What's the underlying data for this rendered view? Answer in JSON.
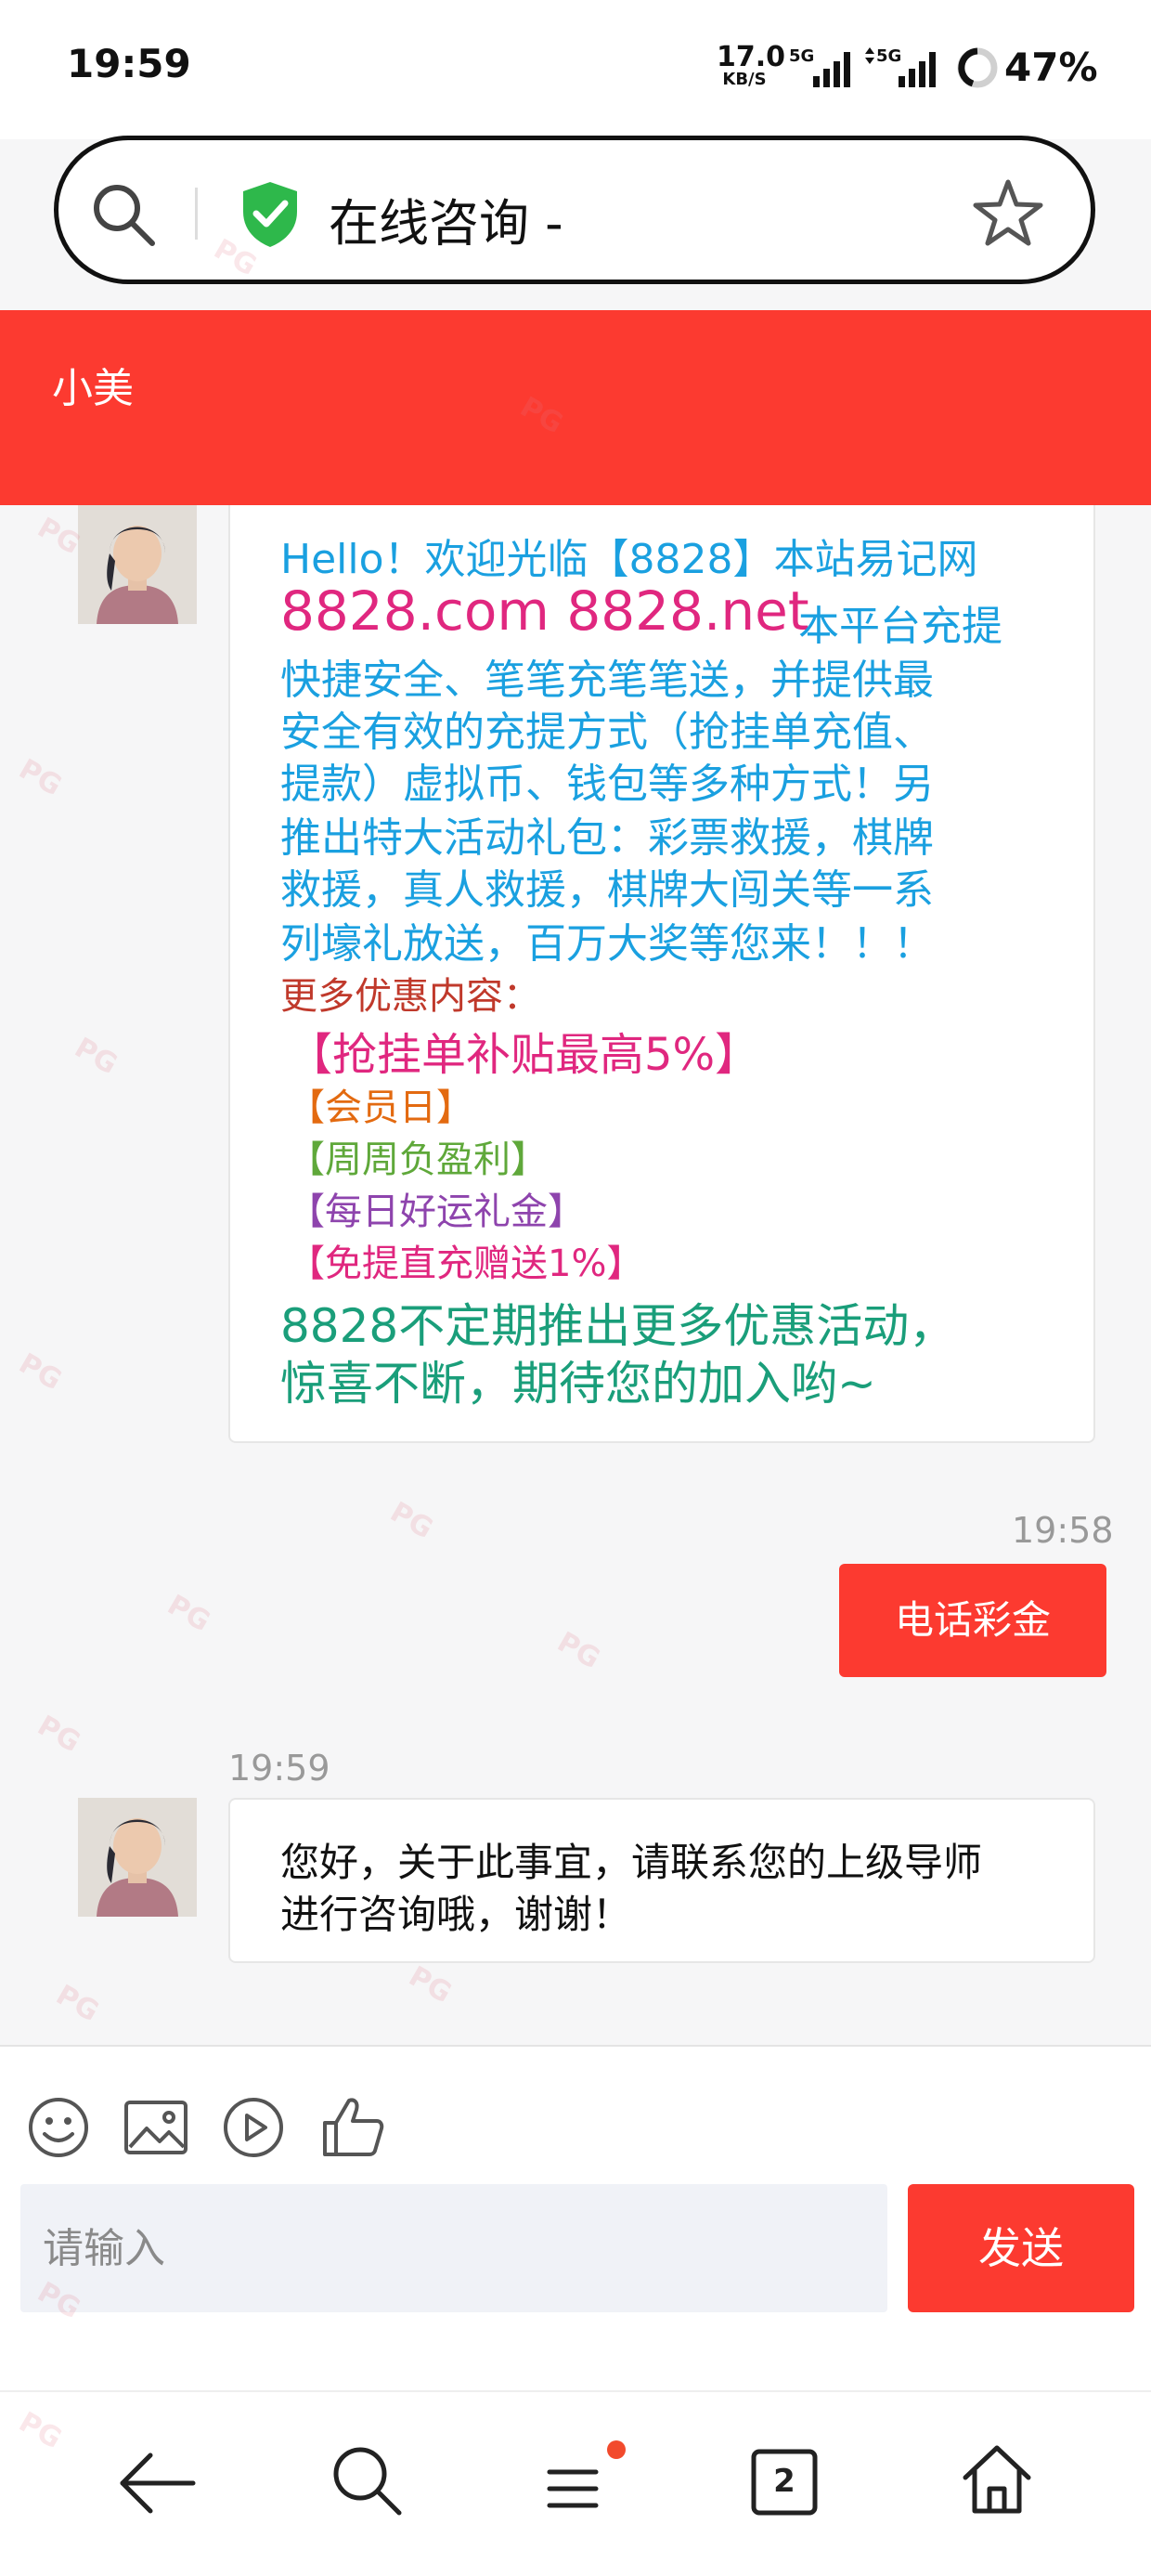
{
  "status_bar": {
    "time": "19:59",
    "net_speed_value": "17.0",
    "net_speed_unit": "KB/S",
    "signal1_label": "5G",
    "signal2_label": "5G",
    "battery_text": "47%"
  },
  "address_bar": {
    "title": "在线咨询 -"
  },
  "header": {
    "agent_name": "小美"
  },
  "welcome_message": {
    "lines": [
      "Hello！欢迎光临【8828】本站易记网",
      "8828.com 8828.net",
      "本平台充提",
      "快捷安全、笔笔充笔笔送，并提供最",
      "安全有效的充提方式（抢挂单充值、",
      "提款）虚拟币、钱包等多种方式！另",
      "推出特大活动礼包：彩票救援，棋牌",
      "救援，真人救援，棋牌大闯关等一系",
      "列壕礼放送，百万大奖等您来！！！",
      "更多优惠内容：",
      "【抢挂单补贴最高5%】",
      "【会员日】",
      "【周周负盈利】",
      "【每日好运礼金】",
      "【免提直充赠送1%】",
      "8828不定期推出更多优惠活动，",
      "惊喜不断，期待您的加入哟~"
    ]
  },
  "sent_message": {
    "timestamp": "19:58",
    "text": "电话彩金"
  },
  "reply_message": {
    "timestamp": "19:59",
    "line1": "您好，关于此事宜，请联系您的上级导师",
    "line2": "进行咨询哦，谢谢！"
  },
  "composer": {
    "placeholder": "请输入",
    "send_label": "发送"
  },
  "bottom_nav": {
    "tabs_count": "2"
  },
  "watermark": "PG",
  "colors": {
    "accent": "#fc3a30",
    "cyan": "#1aa0e0",
    "magenta": "#e0277f",
    "green": "#1a9e7a"
  }
}
